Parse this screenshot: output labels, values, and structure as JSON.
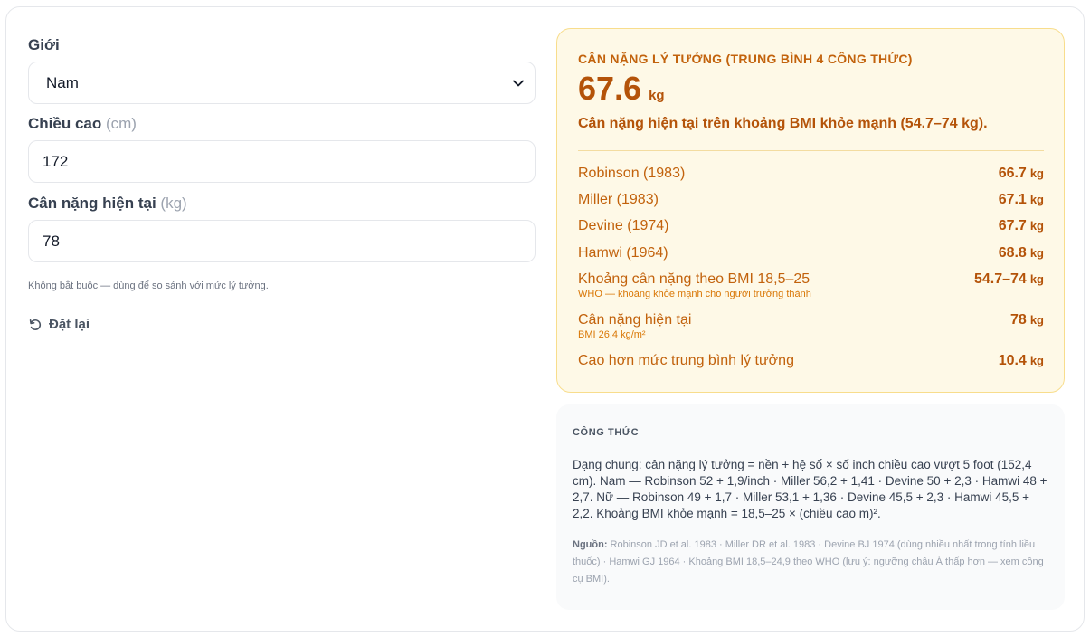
{
  "form": {
    "gender": {
      "label": "Giới",
      "value": "Nam"
    },
    "height": {
      "label": "Chiều cao",
      "unit": "(cm)",
      "value": "172"
    },
    "weight": {
      "label": "Cân nặng hiện tại",
      "unit": "(kg)",
      "value": "78"
    },
    "hint": "Không bắt buộc — dùng để so sánh với mức lý tưởng.",
    "reset_label": "Đặt lại"
  },
  "result": {
    "title": "CÂN NẶNG LÝ TƯỞNG (TRUNG BÌNH 4 CÔNG THỨC)",
    "value": "67.6",
    "unit": "kg",
    "status": "Cân nặng hiện tại trên khoảng BMI khỏe mạnh (54.7–74 kg).",
    "rows": [
      {
        "label": "Robinson (1983)",
        "value": "66.7",
        "unit": "kg"
      },
      {
        "label": "Miller (1983)",
        "value": "67.1",
        "unit": "kg"
      },
      {
        "label": "Devine (1974)",
        "value": "67.7",
        "unit": "kg"
      },
      {
        "label": "Hamwi (1964)",
        "value": "68.8",
        "unit": "kg"
      },
      {
        "label": "Khoảng cân nặng theo BMI 18,5–25",
        "sub": "WHO — khoảng khỏe mạnh cho người trưởng thành",
        "value": "54.7–74",
        "unit": "kg"
      },
      {
        "label": "Cân nặng hiện tại",
        "sub": "BMI 26.4 kg/m²",
        "value": "78",
        "unit": "kg"
      },
      {
        "label": "Cao hơn mức trung bình lý tưởng",
        "value": "10.4",
        "unit": "kg"
      }
    ]
  },
  "formula": {
    "title": "CÔNG THỨC",
    "body": "Dạng chung: cân nặng lý tưởng = nền + hệ số × số inch chiều cao vượt 5 foot (152,4 cm). Nam — Robinson 52 + 1,9/inch · Miller 56,2 + 1,41 · Devine 50 + 2,3 · Hamwi 48 + 2,7. Nữ — Robinson 49 + 1,7 · Miller 53,1 + 1,36 · Devine 45,5 + 2,3 · Hamwi 45,5 + 2,2. Khoảng BMI khỏe mạnh = 18,5–25 × (chiều cao m)².",
    "source_label": "Nguồn:",
    "source_text": "Robinson JD et al. 1983 · Miller DR et al. 1983 · Devine BJ 1974 (dùng nhiều nhất trong tính liều thuốc) · Hamwi GJ 1964 · Khoảng BMI 18,5–24,9 theo WHO (lưu ý: ngưỡng châu Á thấp hơn — xem công cụ BMI)."
  },
  "icons": {
    "select": "chevron-down-icon",
    "reset": "rotate-ccw-icon"
  }
}
